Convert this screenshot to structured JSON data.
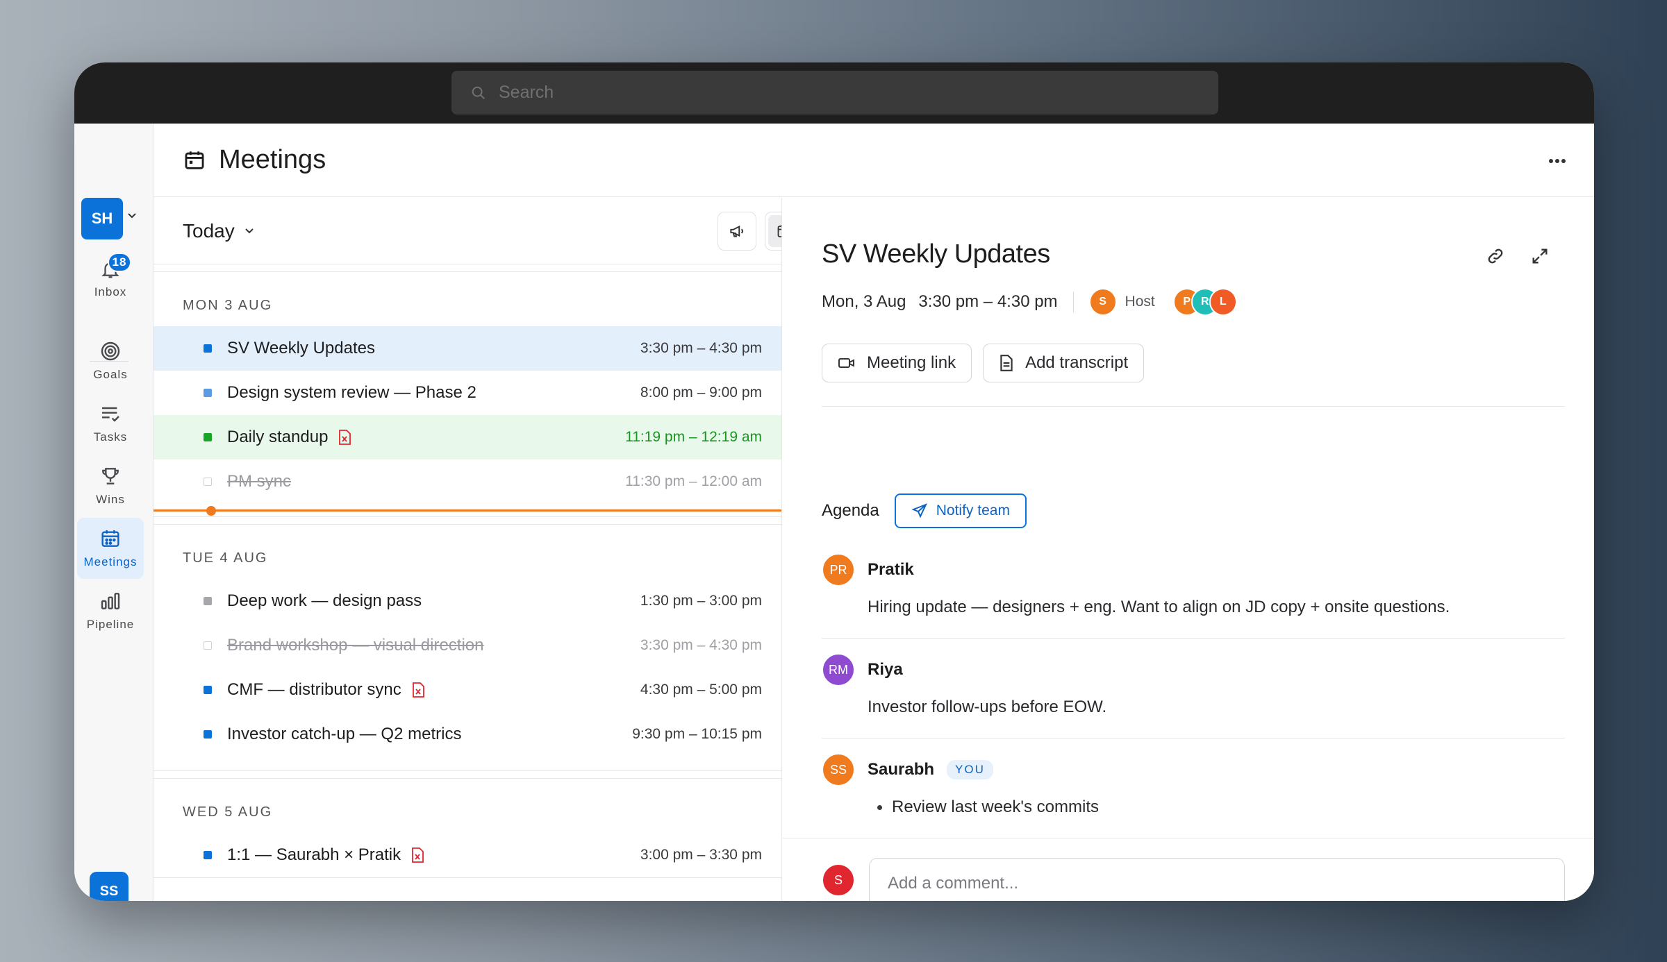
{
  "search": {
    "placeholder": "Search"
  },
  "workspace": {
    "initials": "SH"
  },
  "rail": {
    "inbox": {
      "label": "Inbox",
      "badge": "18"
    },
    "items": [
      {
        "key": "goals",
        "label": "Goals"
      },
      {
        "key": "tasks",
        "label": "Tasks"
      },
      {
        "key": "wins",
        "label": "Wins"
      },
      {
        "key": "meetings",
        "label": "Meetings",
        "active": true
      },
      {
        "key": "pipeline",
        "label": "Pipeline"
      }
    ],
    "user_initials": "SS"
  },
  "header": {
    "title": "Meetings"
  },
  "list": {
    "range_label": "Today",
    "days": [
      {
        "label": "MON 3 AUG",
        "meetings": [
          {
            "name": "SV Weekly Updates",
            "time": "3:30 pm – 4:30 pm",
            "state": "selected",
            "color": "#0b72d9"
          },
          {
            "name": "Design system review — Phase 2",
            "time": "8:00 pm – 9:00 pm",
            "state": "normal",
            "color": "#5a9be3"
          },
          {
            "name": "Daily standup",
            "time": "11:19 pm – 12:19 am",
            "state": "live",
            "color": "#17a525",
            "pdf": true
          },
          {
            "name": "PM sync",
            "time": "11:30 pm – 12:00 am",
            "state": "done",
            "color": "transparent"
          }
        ]
      },
      {
        "label": "TUE 4 AUG",
        "meetings": [
          {
            "name": "Deep work — design pass",
            "time": "1:30 pm – 3:00 pm",
            "state": "normal",
            "color": "#a6a6ab"
          },
          {
            "name": "Brand workshop — visual direction",
            "time": "3:30 pm – 4:30 pm",
            "state": "done",
            "color": "transparent"
          },
          {
            "name": "CMF — distributor sync",
            "time": "4:30 pm – 5:00 pm",
            "state": "normal",
            "color": "#0b72d9",
            "pdf": true
          },
          {
            "name": "Investor catch-up — Q2 metrics",
            "time": "9:30 pm – 10:15 pm",
            "state": "normal",
            "color": "#0b72d9"
          }
        ]
      },
      {
        "label": "WED 5 AUG",
        "meetings": [
          {
            "name": "1:1 — Saurabh × Pratik",
            "time": "3:00 pm – 3:30 pm",
            "state": "normal",
            "color": "#0b72d9",
            "pdf": true
          }
        ]
      }
    ]
  },
  "detail": {
    "title": "SV Weekly Updates",
    "date": "Mon, 3 Aug",
    "time": "3:30 pm – 4:30 pm",
    "host": {
      "initial": "S",
      "label": "Host",
      "color": "#f07b1f"
    },
    "attendees": [
      {
        "initial": "P",
        "color": "#f07b1f"
      },
      {
        "initial": "R",
        "color": "#1fbfb8"
      },
      {
        "initial": "L",
        "color": "#f05a24"
      }
    ],
    "meeting_link_label": "Meeting link",
    "add_transcript_label": "Add transcript",
    "agenda_label": "Agenda",
    "notify_label": "Notify team",
    "notes": [
      {
        "initials": "PR",
        "name": "Pratik",
        "color": "#f07b1f",
        "text": "Hiring update — designers + eng. Want to align on JD copy + onsite questions."
      },
      {
        "initials": "RM",
        "name": "Riya",
        "color": "#8e4bd1",
        "text": "Investor follow-ups before EOW."
      },
      {
        "initials": "SS",
        "name": "Saurabh",
        "color": "#f07b1f",
        "you_label": "YOU",
        "bullets": [
          "Review last week's commits"
        ]
      }
    ],
    "comment": {
      "avatar_initial": "S",
      "avatar_color": "#e0262f",
      "placeholder": "Add a comment..."
    }
  }
}
